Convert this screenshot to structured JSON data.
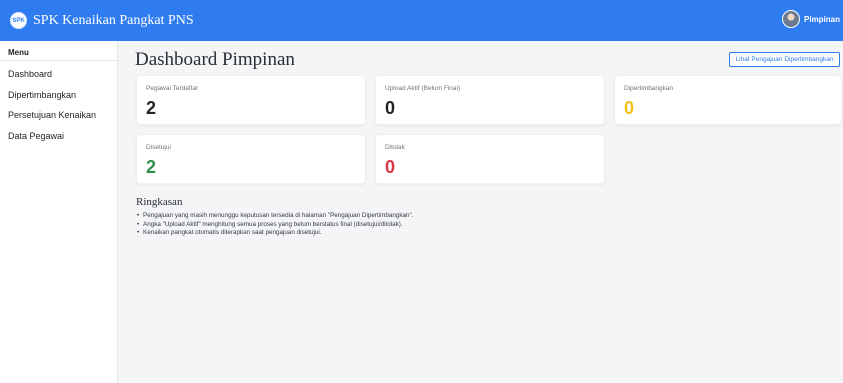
{
  "app": {
    "logo_text": "SPK",
    "title": "SPK Kenaikan Pangkat PNS",
    "user_name": "Pimpinan",
    "accent_color": "#2f7cf0"
  },
  "sidebar": {
    "title": "Menu",
    "items": [
      {
        "label": "Dashboard"
      },
      {
        "label": "Dipertimbangkan"
      },
      {
        "label": "Persetujuan Kenaikan"
      },
      {
        "label": "Data Pegawai"
      }
    ]
  },
  "main": {
    "title": "Dashboard Pimpinan",
    "action_label": "Lihat Pengajuan Dipertimbangkan",
    "cards": [
      {
        "label": "Pegawai Terdaftar",
        "value": "2",
        "color": "#212529"
      },
      {
        "label": "Upload Aktif (Belum Final)",
        "value": "0",
        "color": "#212529"
      },
      {
        "label": "Dipertimbangkan",
        "value": "0",
        "color": "#f2c31b"
      },
      {
        "label": "Disetujui",
        "value": "2",
        "color": "#2f8f4e"
      },
      {
        "label": "Ditolak",
        "value": "0",
        "color": "#dc3545"
      }
    ],
    "summary": {
      "title": "Ringkasan",
      "items": [
        "Pengajuan yang masih menunggu keputusan tersedia di halaman \"Pengajuan Dipertimbangkan\".",
        "Angka \"Upload Aktif\" menghitung semua proses yang belum berstatus final (disetujui/ditolak).",
        "Kenaikan pangkat otomatis diterapkan saat pengajuan disetujui."
      ]
    }
  }
}
